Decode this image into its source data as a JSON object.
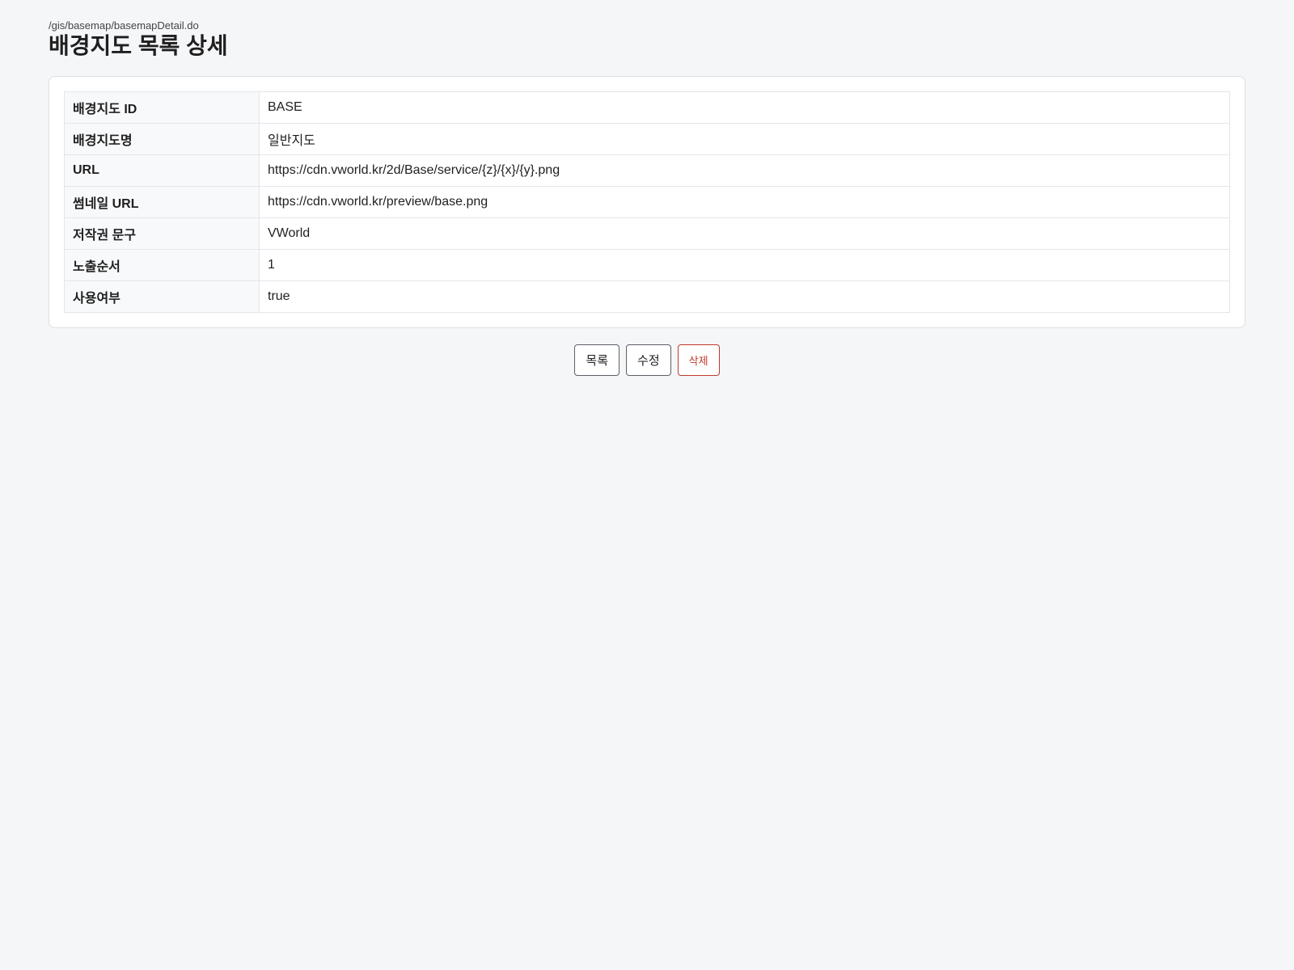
{
  "header": {
    "path": "/gis/basemap/basemapDetail.do",
    "title": "배경지도 목록 상세"
  },
  "detail": {
    "rows": [
      {
        "label": "배경지도 ID",
        "value": "BASE"
      },
      {
        "label": "배경지도명",
        "value": "일반지도"
      },
      {
        "label": "URL",
        "value": "https://cdn.vworld.kr/2d/Base/service/{z}/{x}/{y}.png"
      },
      {
        "label": "썸네일 URL",
        "value": "https://cdn.vworld.kr/preview/base.png"
      },
      {
        "label": "저작권 문구",
        "value": "VWorld"
      },
      {
        "label": "노출순서",
        "value": "1"
      },
      {
        "label": "사용여부",
        "value": "true"
      }
    ]
  },
  "actions": {
    "list_label": "목록",
    "edit_label": "수정",
    "delete_label": "삭제"
  },
  "colors": {
    "background": "#f5f6f8",
    "delete_accent": "#c0392b"
  }
}
